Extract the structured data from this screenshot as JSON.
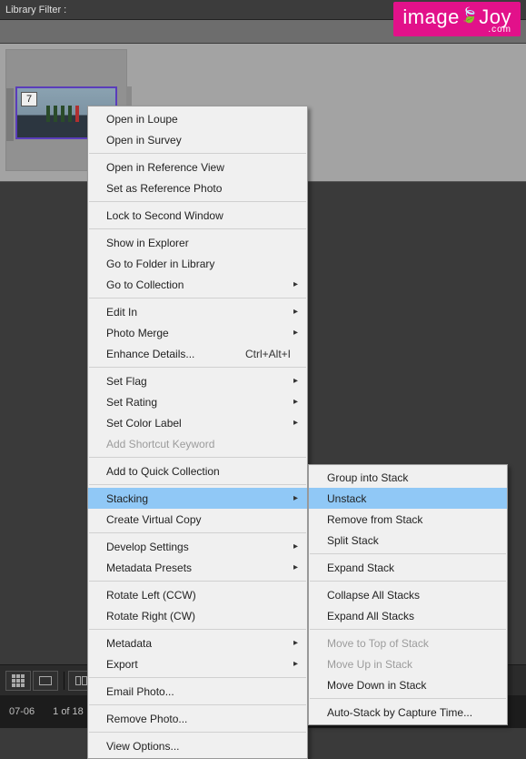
{
  "header": {
    "library_filter_label": "Library Filter :"
  },
  "brand": {
    "text1": "ima",
    "text2": "e",
    "text3": "J",
    "text4": "oy",
    "domain": ".com"
  },
  "thumbnail": {
    "stack_count": "7"
  },
  "status": {
    "date": "07-06",
    "count": "1 of 18"
  },
  "context_menu": {
    "items": [
      {
        "label": "Open in Loupe",
        "sub": false
      },
      {
        "label": "Open in Survey",
        "sub": false
      },
      {
        "sep": true
      },
      {
        "label": "Open in Reference View",
        "sub": false
      },
      {
        "label": "Set as Reference Photo",
        "sub": false
      },
      {
        "sep": true
      },
      {
        "label": "Lock to Second Window",
        "sub": false
      },
      {
        "sep": true
      },
      {
        "label": "Show in Explorer",
        "sub": false
      },
      {
        "label": "Go to Folder in Library",
        "sub": false
      },
      {
        "label": "Go to Collection",
        "sub": true
      },
      {
        "sep": true
      },
      {
        "label": "Edit In",
        "sub": true
      },
      {
        "label": "Photo Merge",
        "sub": true
      },
      {
        "label": "Enhance Details...",
        "sub": false,
        "shortcut": "Ctrl+Alt+I"
      },
      {
        "sep": true
      },
      {
        "label": "Set Flag",
        "sub": true
      },
      {
        "label": "Set Rating",
        "sub": true
      },
      {
        "label": "Set Color Label",
        "sub": true
      },
      {
        "label": "Add Shortcut Keyword",
        "sub": false,
        "disabled": true
      },
      {
        "sep": true
      },
      {
        "label": "Add to Quick Collection",
        "sub": false
      },
      {
        "sep": true
      },
      {
        "label": "Stacking",
        "sub": true,
        "highlight": true
      },
      {
        "label": "Create Virtual Copy",
        "sub": false
      },
      {
        "sep": true
      },
      {
        "label": "Develop Settings",
        "sub": true
      },
      {
        "label": "Metadata Presets",
        "sub": true
      },
      {
        "sep": true
      },
      {
        "label": "Rotate Left (CCW)",
        "sub": false
      },
      {
        "label": "Rotate Right (CW)",
        "sub": false
      },
      {
        "sep": true
      },
      {
        "label": "Metadata",
        "sub": true
      },
      {
        "label": "Export",
        "sub": true
      },
      {
        "sep": true
      },
      {
        "label": "Email Photo...",
        "sub": false
      },
      {
        "sep": true
      },
      {
        "label": "Remove Photo...",
        "sub": false
      },
      {
        "sep": true
      },
      {
        "label": "View Options...",
        "sub": false
      }
    ]
  },
  "submenu": {
    "items": [
      {
        "label": "Group into Stack",
        "sub": false
      },
      {
        "label": "Unstack",
        "sub": false,
        "highlight": true
      },
      {
        "label": "Remove from Stack",
        "sub": false
      },
      {
        "label": "Split Stack",
        "sub": false
      },
      {
        "sep": true
      },
      {
        "label": "Expand Stack",
        "sub": false
      },
      {
        "sep": true
      },
      {
        "label": "Collapse All Stacks",
        "sub": false
      },
      {
        "label": "Expand All Stacks",
        "sub": false
      },
      {
        "sep": true
      },
      {
        "label": "Move to Top of Stack",
        "sub": false,
        "disabled": true
      },
      {
        "label": "Move Up in Stack",
        "sub": false,
        "disabled": true
      },
      {
        "label": "Move Down in Stack",
        "sub": false
      },
      {
        "sep": true
      },
      {
        "label": "Auto-Stack by Capture Time...",
        "sub": false
      }
    ]
  }
}
